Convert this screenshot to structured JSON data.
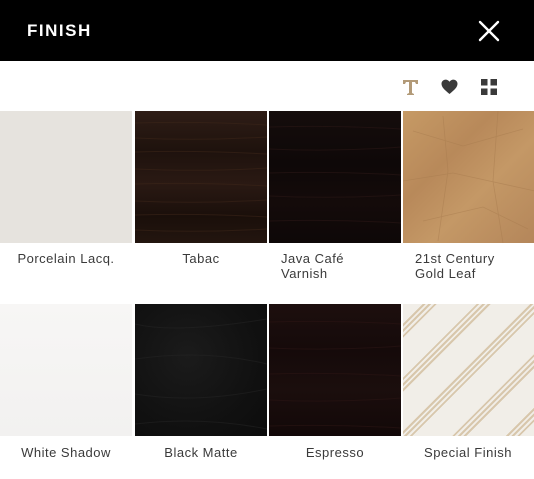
{
  "header": {
    "title": "FINISH",
    "close_icon": "close-icon"
  },
  "toolbar": {
    "icons": [
      "text-icon",
      "heart-icon",
      "grid-icon"
    ],
    "accent_color": "#b29a78",
    "icon_color": "#3a3a3a"
  },
  "swatches": [
    {
      "label": "Porcelain Lacq.",
      "color": "#e6e3de"
    },
    {
      "label": "Tabac",
      "color": "#271811"
    },
    {
      "label": "Java Café Varnish",
      "color": "#120a09"
    },
    {
      "label": "21st Century Gold Leaf",
      "color": "#c08f5e"
    },
    {
      "label": "White Shadow",
      "color": "#f4f3f2"
    },
    {
      "label": "Black Matte",
      "color": "#141414"
    },
    {
      "label": "Espresso",
      "color": "#180c0b"
    },
    {
      "label": "Special Finish",
      "color": "#e8dfd0"
    }
  ]
}
